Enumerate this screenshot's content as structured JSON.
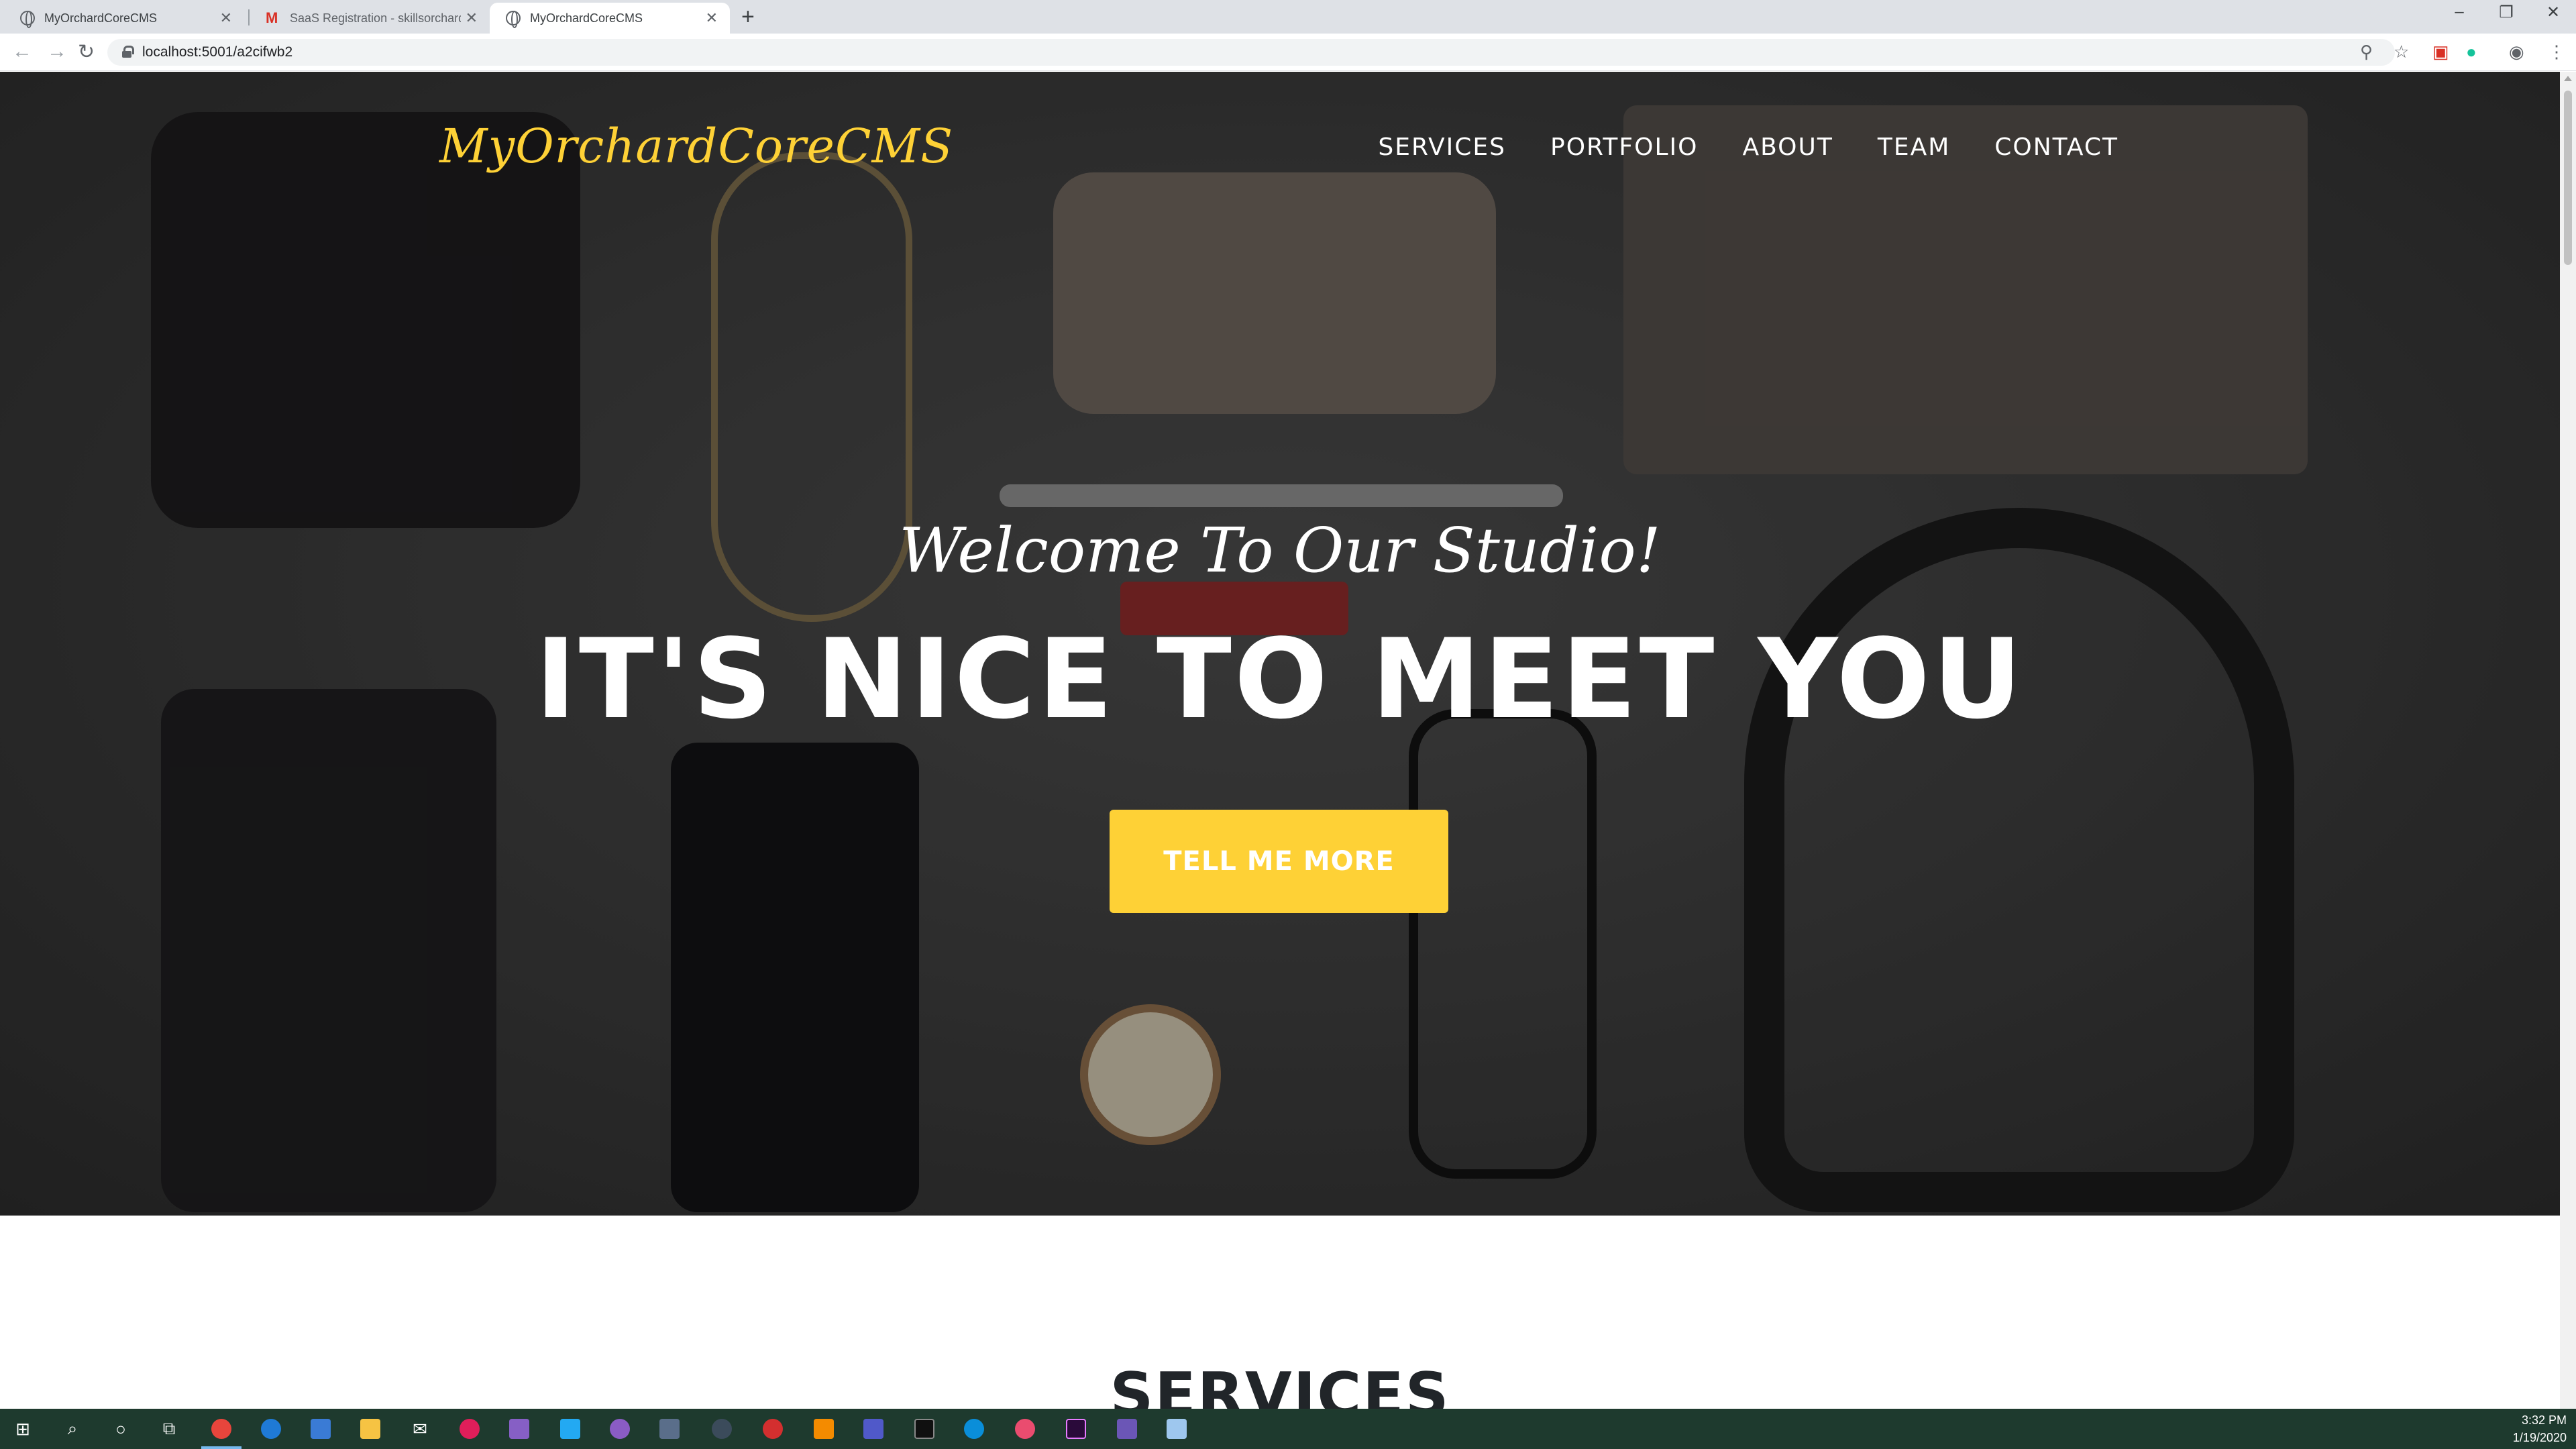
{
  "browser": {
    "tabs": [
      {
        "title": "MyOrchardCoreCMS",
        "active": false
      },
      {
        "title": "SaaS Registration - skillsorchard",
        "active": false
      },
      {
        "title": "MyOrchardCoreCMS",
        "active": true
      }
    ],
    "new_tab_icon": "plus-icon",
    "url": "localhost:5001/a2cifwb2"
  },
  "site": {
    "brand": "MyOrchardCoreCMS",
    "nav": [
      "SERVICES",
      "PORTFOLIO",
      "ABOUT",
      "TEAM",
      "CONTACT"
    ],
    "hero": {
      "subheading": "Welcome To Our Studio!",
      "heading": "IT'S NICE TO MEET YOU",
      "button": "TELL ME MORE"
    },
    "services_heading": "SERVICES",
    "colors": {
      "accent": "#fed136",
      "text": "#ffffff",
      "dark": "#212529"
    }
  },
  "taskbar": {
    "time": "3:32 PM",
    "date": "1/19/2020",
    "apps": [
      "windows-start-icon",
      "search-icon",
      "cortana-icon",
      "task-view-icon",
      "chrome-icon",
      "edge-icon",
      "store-icon",
      "file-explorer-icon",
      "mail-icon",
      "slack-icon",
      "visual-studio-icon",
      "vscode-icon",
      "github-icon",
      "app-icon",
      "app-icon",
      "app-icon",
      "vlc-icon",
      "teams-icon",
      "terminal-icon",
      "skype-icon",
      "app-icon",
      "premiere-icon",
      "app-icon",
      "app-icon"
    ]
  }
}
